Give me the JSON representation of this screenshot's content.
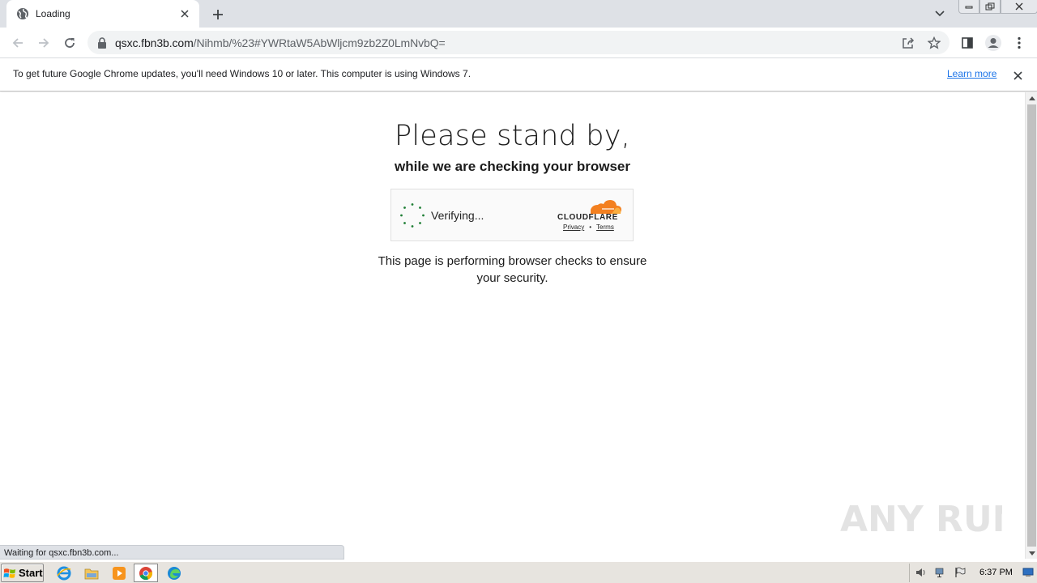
{
  "tab": {
    "title": "Loading"
  },
  "address_bar": {
    "host": "qsxc.fbn3b.com",
    "path": "/Nihmb/%23#YWRtaW5AbWljcm9zb2Z0LmNvbQ="
  },
  "infobar": {
    "message": "To get future Google Chrome updates, you'll need Windows 10 or later. This computer is using Windows 7.",
    "link": "Learn more"
  },
  "page": {
    "headline": "Please stand by,",
    "subheadline": "while we are checking your browser",
    "widget": {
      "status": "Verifying...",
      "brand": "CLOUDFLARE",
      "privacy": "Privacy",
      "separator": "•",
      "terms": "Terms"
    },
    "message_line1": "This page is performing browser checks to ensure",
    "message_line2": "your security."
  },
  "status_bar": {
    "text": "Waiting for qsxc.fbn3b.com..."
  },
  "taskbar": {
    "start_label": "Start",
    "clock": "6:37 PM"
  },
  "watermark": {
    "text": "ANY RUN"
  },
  "colors": {
    "cloudflare_orange": "#f38020",
    "cloudflare_light": "#faae40",
    "spinner_green": "#1e7e34",
    "link_blue": "#1a73e8"
  }
}
